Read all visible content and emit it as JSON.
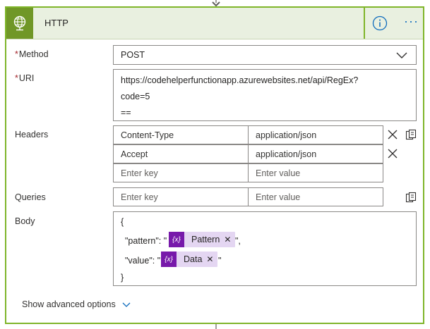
{
  "action": {
    "title": "HTTP",
    "info_icon": "info-icon",
    "more_label": "···"
  },
  "method": {
    "label": "Method",
    "required_mark": "*",
    "value": "POST"
  },
  "uri": {
    "label": "URI",
    "required_mark": "*",
    "line1": "https://codehelperfunctionapp.azurewebsites.net/api/RegEx?",
    "line2": "code=5",
    "line3": "=="
  },
  "headers": {
    "label": "Headers",
    "rows": [
      {
        "key": "Content-Type",
        "value": "application/json"
      },
      {
        "key": "Accept",
        "value": "application/json"
      }
    ],
    "key_placeholder": "Enter key",
    "value_placeholder": "Enter value"
  },
  "queries": {
    "label": "Queries",
    "key_placeholder": "Enter key",
    "value_placeholder": "Enter value"
  },
  "body": {
    "label": "Body",
    "open_brace": "{",
    "close_brace": "}",
    "pattern_prefix": "\"pattern\": \"",
    "pattern_suffix": "\",",
    "pattern_token": "Pattern",
    "value_prefix": "\"value\": \"",
    "value_suffix": "\"",
    "value_token": "Data",
    "token_symbol": "{x}"
  },
  "advanced": {
    "label": "Show advanced options"
  },
  "colors": {
    "accent_green": "#7fb52a",
    "icon_green": "#709727",
    "token_purple": "#7719aa",
    "token_bg": "#e4d6f2",
    "link_blue": "#0f6cbd"
  }
}
